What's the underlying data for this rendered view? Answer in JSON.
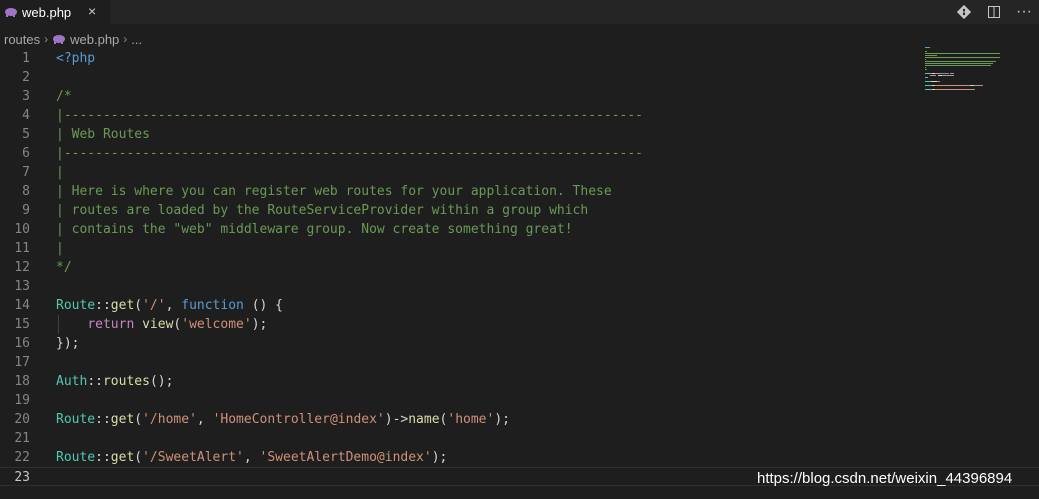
{
  "tab": {
    "label": "web.php",
    "close_icon": "×",
    "icon": "php-elephant-icon",
    "icon_color": "#a074c4"
  },
  "actions": {
    "git_icon": "git-compare-icon",
    "split_icon": "split-editor-icon",
    "more_icon": "more-actions-icon",
    "more_glyph": "···"
  },
  "breadcrumb": {
    "folder": "routes",
    "file": "web.php",
    "ellipsis": "..."
  },
  "editor": {
    "lines": [
      {
        "n": "1",
        "tokens": [
          {
            "t": "<?php",
            "c": "tag"
          }
        ]
      },
      {
        "n": "2",
        "tokens": []
      },
      {
        "n": "3",
        "tokens": [
          {
            "t": "/*",
            "c": "comment"
          }
        ]
      },
      {
        "n": "4",
        "tokens": [
          {
            "t": "|--------------------------------------------------------------------------",
            "c": "comment"
          }
        ]
      },
      {
        "n": "5",
        "tokens": [
          {
            "t": "| Web Routes",
            "c": "comment"
          }
        ]
      },
      {
        "n": "6",
        "tokens": [
          {
            "t": "|--------------------------------------------------------------------------",
            "c": "comment"
          }
        ]
      },
      {
        "n": "7",
        "tokens": [
          {
            "t": "|",
            "c": "comment"
          }
        ]
      },
      {
        "n": "8",
        "tokens": [
          {
            "t": "| Here is where you can register web routes for your application. These",
            "c": "comment"
          }
        ]
      },
      {
        "n": "9",
        "tokens": [
          {
            "t": "| routes are loaded by the RouteServiceProvider within a group which",
            "c": "comment"
          }
        ]
      },
      {
        "n": "10",
        "tokens": [
          {
            "t": "| contains the \"web\" middleware group. Now create something great!",
            "c": "comment"
          }
        ]
      },
      {
        "n": "11",
        "tokens": [
          {
            "t": "|",
            "c": "comment"
          }
        ]
      },
      {
        "n": "12",
        "tokens": [
          {
            "t": "*/",
            "c": "comment"
          }
        ]
      },
      {
        "n": "13",
        "tokens": []
      },
      {
        "n": "14",
        "tokens": [
          {
            "t": "Route",
            "c": "class"
          },
          {
            "t": "::",
            "c": "op"
          },
          {
            "t": "get",
            "c": "func"
          },
          {
            "t": "(",
            "c": "op"
          },
          {
            "t": "'/'",
            "c": "str"
          },
          {
            "t": ", ",
            "c": "op"
          },
          {
            "t": "function",
            "c": "kw"
          },
          {
            "t": " () {",
            "c": "op"
          }
        ]
      },
      {
        "n": "15",
        "tokens": [
          {
            "t": "    ",
            "c": "op"
          },
          {
            "t": "return",
            "c": "ctrl"
          },
          {
            "t": " ",
            "c": "op"
          },
          {
            "t": "view",
            "c": "func"
          },
          {
            "t": "(",
            "c": "op"
          },
          {
            "t": "'welcome'",
            "c": "str"
          },
          {
            "t": ");",
            "c": "op"
          }
        ]
      },
      {
        "n": "16",
        "tokens": [
          {
            "t": "});",
            "c": "op"
          }
        ]
      },
      {
        "n": "17",
        "tokens": []
      },
      {
        "n": "18",
        "tokens": [
          {
            "t": "Auth",
            "c": "class"
          },
          {
            "t": "::",
            "c": "op"
          },
          {
            "t": "routes",
            "c": "func"
          },
          {
            "t": "();",
            "c": "op"
          }
        ]
      },
      {
        "n": "19",
        "tokens": []
      },
      {
        "n": "20",
        "tokens": [
          {
            "t": "Route",
            "c": "class"
          },
          {
            "t": "::",
            "c": "op"
          },
          {
            "t": "get",
            "c": "func"
          },
          {
            "t": "(",
            "c": "op"
          },
          {
            "t": "'/home'",
            "c": "str"
          },
          {
            "t": ", ",
            "c": "op"
          },
          {
            "t": "'HomeController@index'",
            "c": "str"
          },
          {
            "t": ")->",
            "c": "op"
          },
          {
            "t": "name",
            "c": "func"
          },
          {
            "t": "(",
            "c": "op"
          },
          {
            "t": "'home'",
            "c": "str"
          },
          {
            "t": ");",
            "c": "op"
          }
        ]
      },
      {
        "n": "21",
        "tokens": []
      },
      {
        "n": "22",
        "tokens": [
          {
            "t": "Route",
            "c": "class"
          },
          {
            "t": "::",
            "c": "op"
          },
          {
            "t": "get",
            "c": "func"
          },
          {
            "t": "(",
            "c": "op"
          },
          {
            "t": "'/SweetAlert'",
            "c": "str"
          },
          {
            "t": ", ",
            "c": "op"
          },
          {
            "t": "'SweetAlertDemo@index'",
            "c": "str"
          },
          {
            "t": ");",
            "c": "op"
          }
        ]
      },
      {
        "n": "23",
        "tokens": [],
        "current": true
      }
    ]
  },
  "colors": {
    "background": "#1e1e1e",
    "tabbar": "#252526",
    "comment": "#6a9955",
    "string": "#ce9178",
    "keyword": "#569cd6",
    "class": "#4ec9b0",
    "function": "#dcdcaa"
  },
  "watermark": "https://blog.csdn.net/weixin_44396894"
}
